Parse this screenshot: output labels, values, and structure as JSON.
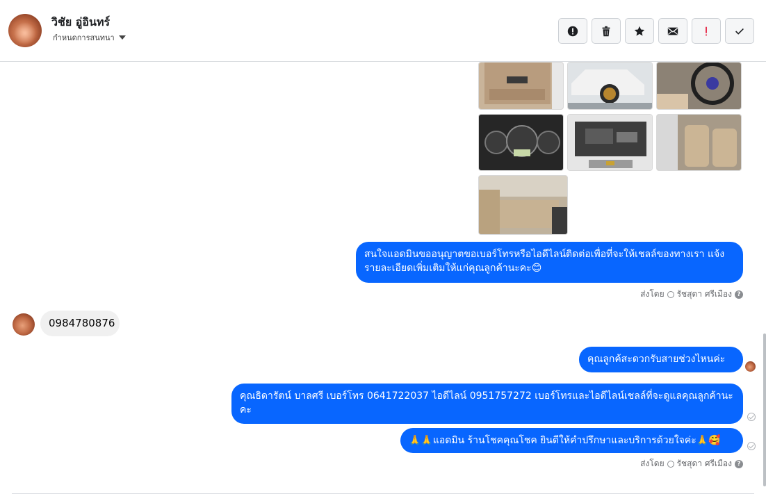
{
  "header": {
    "contact_name": "วิชัย อู่อินทร์",
    "assign_label": "กำหนดการสนทนา",
    "toolbar": [
      {
        "name": "report-spam-button",
        "icon": "alert-circle-icon"
      },
      {
        "name": "delete-button",
        "icon": "trash-icon"
      },
      {
        "name": "star-button",
        "icon": "star-icon"
      },
      {
        "name": "mark-unread-button",
        "icon": "envelope-icon"
      },
      {
        "name": "follow-up-button",
        "icon": "exclamation-icon",
        "color": "#e41e3f"
      },
      {
        "name": "mark-done-button",
        "icon": "check-icon"
      }
    ]
  },
  "messages": {
    "outgoing_1": "สนใจแอดมินขออนุญาตขอเบอร์โทรหรือไอดีไลน์ติดต่อเพื่อที่จะให้เชลล์ของทางเรา แจ้งรายละเอียดเพิ่มเติมให้แก่คุณลูกค้านะคะ😊",
    "sent_by_1": {
      "prefix": "ส่งโดย",
      "name": "รัชสุดา ศรีเมือง",
      "help": "?"
    },
    "incoming_1": "0984780876",
    "outgoing_2": "คุณลูกค้สะดวกรับสายช่วงไหนค่ะ",
    "outgoing_3": "คุณธิดารัตน์ บาลศรี เบอร์โทร 0641722037  ไอดีไลน์ 0951757272   เบอร์โทรและไอดีไลน์เชลล์ที่จะดูแลคุณลูกค้านะคะ",
    "outgoing_4": "🙏🙏แอดมิน ร้านโชคคุณโชค ยินดีให้คำปรึกษาและบริการด้วยใจค่ะ🙏🥰",
    "sent_by_2": {
      "prefix": "ส่งโดย",
      "name": "รัชสุดา ศรีเมือง",
      "help": "?"
    }
  },
  "colors": {
    "outgoing_bubble": "#0866ff",
    "incoming_bubble": "#f0f0f0"
  }
}
